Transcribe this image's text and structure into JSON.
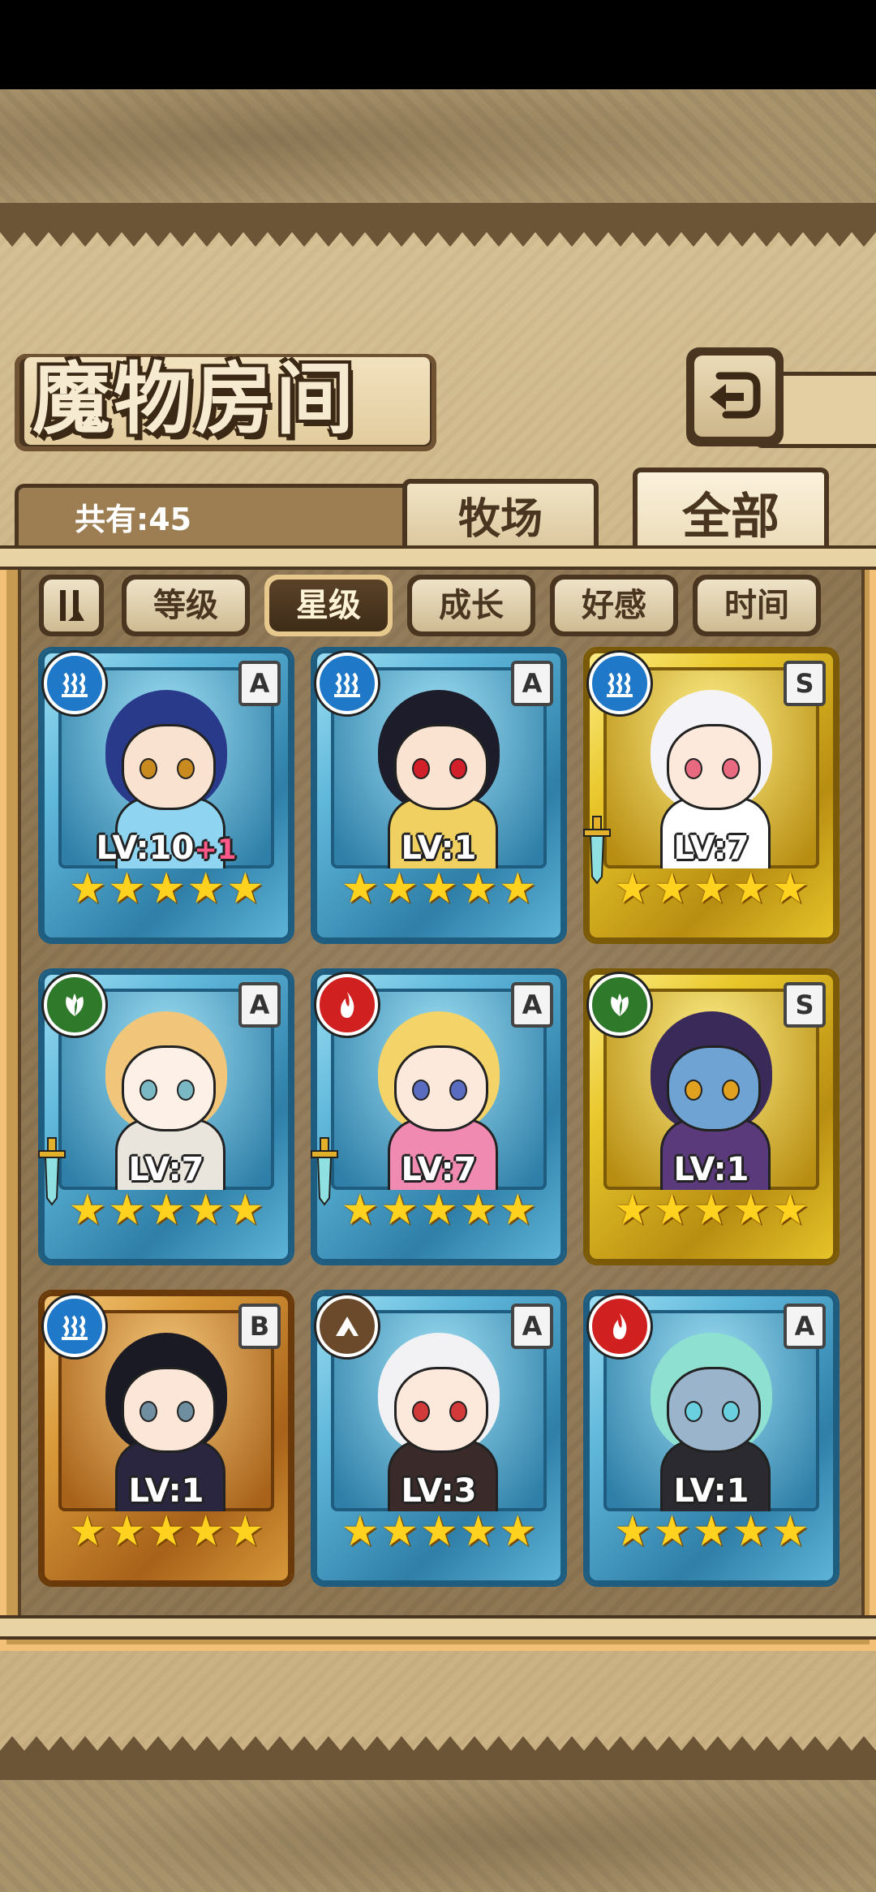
{
  "screen": {
    "title": "魔物房间",
    "count_label": "共有:45"
  },
  "tabs": [
    {
      "label": "牧场",
      "active": false
    },
    {
      "label": "全部",
      "active": true
    }
  ],
  "sort_buttons": [
    {
      "label": "等级",
      "active": false
    },
    {
      "label": "星级",
      "active": true
    },
    {
      "label": "成长",
      "active": false
    },
    {
      "label": "好感",
      "active": false
    },
    {
      "label": "时间",
      "active": false
    }
  ],
  "monsters": [
    {
      "level": "LV:10",
      "level_bonus": "+1",
      "rank": "A",
      "element": "water-icon",
      "stars": 5,
      "frame": "blue",
      "has_weapon": false,
      "colors": {
        "hair": "#2a3a8a",
        "skin": "#f9e2cf",
        "eye": "#c98a20",
        "body": "#8fd4f0"
      }
    },
    {
      "level": "LV:1",
      "level_bonus": "",
      "rank": "A",
      "element": "water-icon",
      "stars": 5,
      "frame": "blue",
      "has_weapon": false,
      "colors": {
        "hair": "#1c1c2a",
        "skin": "#fbe3d1",
        "eye": "#d2202a",
        "body": "#f0d060"
      }
    },
    {
      "level": "LV:7",
      "level_bonus": "",
      "rank": "S",
      "element": "water-icon",
      "stars": 5,
      "frame": "gold",
      "has_weapon": true,
      "colors": {
        "hair": "#f4f4f8",
        "skin": "#fde8dc",
        "eye": "#e86a80",
        "body": "#ffffff"
      }
    },
    {
      "level": "LV:7",
      "level_bonus": "",
      "rank": "A",
      "element": "leaf-icon",
      "stars": 5,
      "frame": "blue",
      "has_weapon": true,
      "colors": {
        "hair": "#f1c67a",
        "skin": "#fdf0e6",
        "eye": "#7ab8c4",
        "body": "#e9e4dc"
      }
    },
    {
      "level": "LV:7",
      "level_bonus": "",
      "rank": "A",
      "element": "fire-icon",
      "stars": 5,
      "frame": "blue",
      "has_weapon": true,
      "colors": {
        "hair": "#f4d468",
        "skin": "#fde8dc",
        "eye": "#5a6cc0",
        "body": "#f08ab0"
      }
    },
    {
      "level": "LV:1",
      "level_bonus": "",
      "rank": "S",
      "element": "leaf-icon",
      "stars": 5,
      "frame": "gold",
      "has_weapon": false,
      "colors": {
        "hair": "#3a2a5a",
        "skin": "#6fa3d4",
        "eye": "#e0a020",
        "body": "#5a3a7a"
      }
    },
    {
      "level": "LV:1",
      "level_bonus": "",
      "rank": "B",
      "element": "water-icon",
      "stars": 5,
      "frame": "bronze",
      "has_weapon": false,
      "colors": {
        "hair": "#1a1a24",
        "skin": "#fbe6d8",
        "eye": "#6f8fa0",
        "body": "#2a2640"
      }
    },
    {
      "level": "LV:3",
      "level_bonus": "",
      "rank": "A",
      "element": "earth-icon",
      "stars": 5,
      "frame": "blue",
      "has_weapon": false,
      "colors": {
        "hair": "#f2f2f4",
        "skin": "#fde8dc",
        "eye": "#d23a3a",
        "body": "#3a2a2a"
      }
    },
    {
      "level": "LV:1",
      "level_bonus": "",
      "rank": "A",
      "element": "fire-icon",
      "stars": 5,
      "frame": "blue",
      "has_weapon": false,
      "colors": {
        "hair": "#8ee0d0",
        "skin": "#9ab4cc",
        "eye": "#6ad0e0",
        "body": "#2a2a30"
      }
    }
  ],
  "palette": {
    "frame_blue": "#5fb7da",
    "frame_gold": "#e8c62a",
    "frame_bronze": "#d99a3a",
    "water": "#1f78c8",
    "leaf": "#2f7a2a",
    "fire": "#d02020",
    "earth": "#6a4a2a"
  }
}
